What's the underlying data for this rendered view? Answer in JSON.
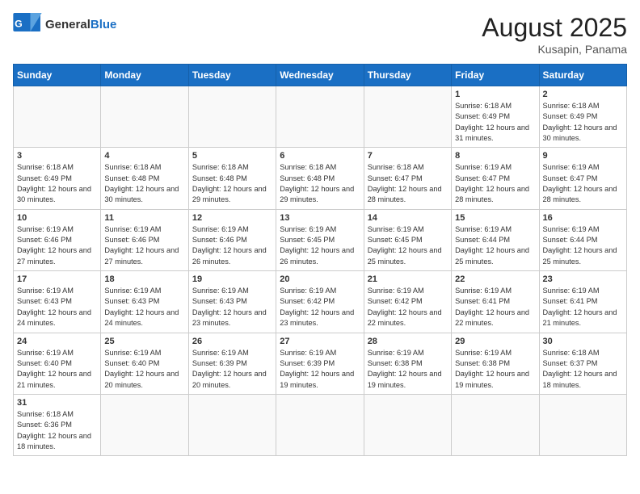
{
  "header": {
    "logo_general": "General",
    "logo_blue": "Blue",
    "month_title": "August 2025",
    "location": "Kusapin, Panama"
  },
  "weekdays": [
    "Sunday",
    "Monday",
    "Tuesday",
    "Wednesday",
    "Thursday",
    "Friday",
    "Saturday"
  ],
  "weeks": [
    [
      {
        "day": "",
        "info": ""
      },
      {
        "day": "",
        "info": ""
      },
      {
        "day": "",
        "info": ""
      },
      {
        "day": "",
        "info": ""
      },
      {
        "day": "",
        "info": ""
      },
      {
        "day": "1",
        "info": "Sunrise: 6:18 AM\nSunset: 6:49 PM\nDaylight: 12 hours and 31 minutes."
      },
      {
        "day": "2",
        "info": "Sunrise: 6:18 AM\nSunset: 6:49 PM\nDaylight: 12 hours and 30 minutes."
      }
    ],
    [
      {
        "day": "3",
        "info": "Sunrise: 6:18 AM\nSunset: 6:49 PM\nDaylight: 12 hours and 30 minutes."
      },
      {
        "day": "4",
        "info": "Sunrise: 6:18 AM\nSunset: 6:48 PM\nDaylight: 12 hours and 30 minutes."
      },
      {
        "day": "5",
        "info": "Sunrise: 6:18 AM\nSunset: 6:48 PM\nDaylight: 12 hours and 29 minutes."
      },
      {
        "day": "6",
        "info": "Sunrise: 6:18 AM\nSunset: 6:48 PM\nDaylight: 12 hours and 29 minutes."
      },
      {
        "day": "7",
        "info": "Sunrise: 6:18 AM\nSunset: 6:47 PM\nDaylight: 12 hours and 28 minutes."
      },
      {
        "day": "8",
        "info": "Sunrise: 6:19 AM\nSunset: 6:47 PM\nDaylight: 12 hours and 28 minutes."
      },
      {
        "day": "9",
        "info": "Sunrise: 6:19 AM\nSunset: 6:47 PM\nDaylight: 12 hours and 28 minutes."
      }
    ],
    [
      {
        "day": "10",
        "info": "Sunrise: 6:19 AM\nSunset: 6:46 PM\nDaylight: 12 hours and 27 minutes."
      },
      {
        "day": "11",
        "info": "Sunrise: 6:19 AM\nSunset: 6:46 PM\nDaylight: 12 hours and 27 minutes."
      },
      {
        "day": "12",
        "info": "Sunrise: 6:19 AM\nSunset: 6:46 PM\nDaylight: 12 hours and 26 minutes."
      },
      {
        "day": "13",
        "info": "Sunrise: 6:19 AM\nSunset: 6:45 PM\nDaylight: 12 hours and 26 minutes."
      },
      {
        "day": "14",
        "info": "Sunrise: 6:19 AM\nSunset: 6:45 PM\nDaylight: 12 hours and 25 minutes."
      },
      {
        "day": "15",
        "info": "Sunrise: 6:19 AM\nSunset: 6:44 PM\nDaylight: 12 hours and 25 minutes."
      },
      {
        "day": "16",
        "info": "Sunrise: 6:19 AM\nSunset: 6:44 PM\nDaylight: 12 hours and 25 minutes."
      }
    ],
    [
      {
        "day": "17",
        "info": "Sunrise: 6:19 AM\nSunset: 6:43 PM\nDaylight: 12 hours and 24 minutes."
      },
      {
        "day": "18",
        "info": "Sunrise: 6:19 AM\nSunset: 6:43 PM\nDaylight: 12 hours and 24 minutes."
      },
      {
        "day": "19",
        "info": "Sunrise: 6:19 AM\nSunset: 6:43 PM\nDaylight: 12 hours and 23 minutes."
      },
      {
        "day": "20",
        "info": "Sunrise: 6:19 AM\nSunset: 6:42 PM\nDaylight: 12 hours and 23 minutes."
      },
      {
        "day": "21",
        "info": "Sunrise: 6:19 AM\nSunset: 6:42 PM\nDaylight: 12 hours and 22 minutes."
      },
      {
        "day": "22",
        "info": "Sunrise: 6:19 AM\nSunset: 6:41 PM\nDaylight: 12 hours and 22 minutes."
      },
      {
        "day": "23",
        "info": "Sunrise: 6:19 AM\nSunset: 6:41 PM\nDaylight: 12 hours and 21 minutes."
      }
    ],
    [
      {
        "day": "24",
        "info": "Sunrise: 6:19 AM\nSunset: 6:40 PM\nDaylight: 12 hours and 21 minutes."
      },
      {
        "day": "25",
        "info": "Sunrise: 6:19 AM\nSunset: 6:40 PM\nDaylight: 12 hours and 20 minutes."
      },
      {
        "day": "26",
        "info": "Sunrise: 6:19 AM\nSunset: 6:39 PM\nDaylight: 12 hours and 20 minutes."
      },
      {
        "day": "27",
        "info": "Sunrise: 6:19 AM\nSunset: 6:39 PM\nDaylight: 12 hours and 19 minutes."
      },
      {
        "day": "28",
        "info": "Sunrise: 6:19 AM\nSunset: 6:38 PM\nDaylight: 12 hours and 19 minutes."
      },
      {
        "day": "29",
        "info": "Sunrise: 6:19 AM\nSunset: 6:38 PM\nDaylight: 12 hours and 19 minutes."
      },
      {
        "day": "30",
        "info": "Sunrise: 6:18 AM\nSunset: 6:37 PM\nDaylight: 12 hours and 18 minutes."
      }
    ],
    [
      {
        "day": "31",
        "info": "Sunrise: 6:18 AM\nSunset: 6:36 PM\nDaylight: 12 hours and 18 minutes."
      },
      {
        "day": "",
        "info": ""
      },
      {
        "day": "",
        "info": ""
      },
      {
        "day": "",
        "info": ""
      },
      {
        "day": "",
        "info": ""
      },
      {
        "day": "",
        "info": ""
      },
      {
        "day": "",
        "info": ""
      }
    ]
  ]
}
